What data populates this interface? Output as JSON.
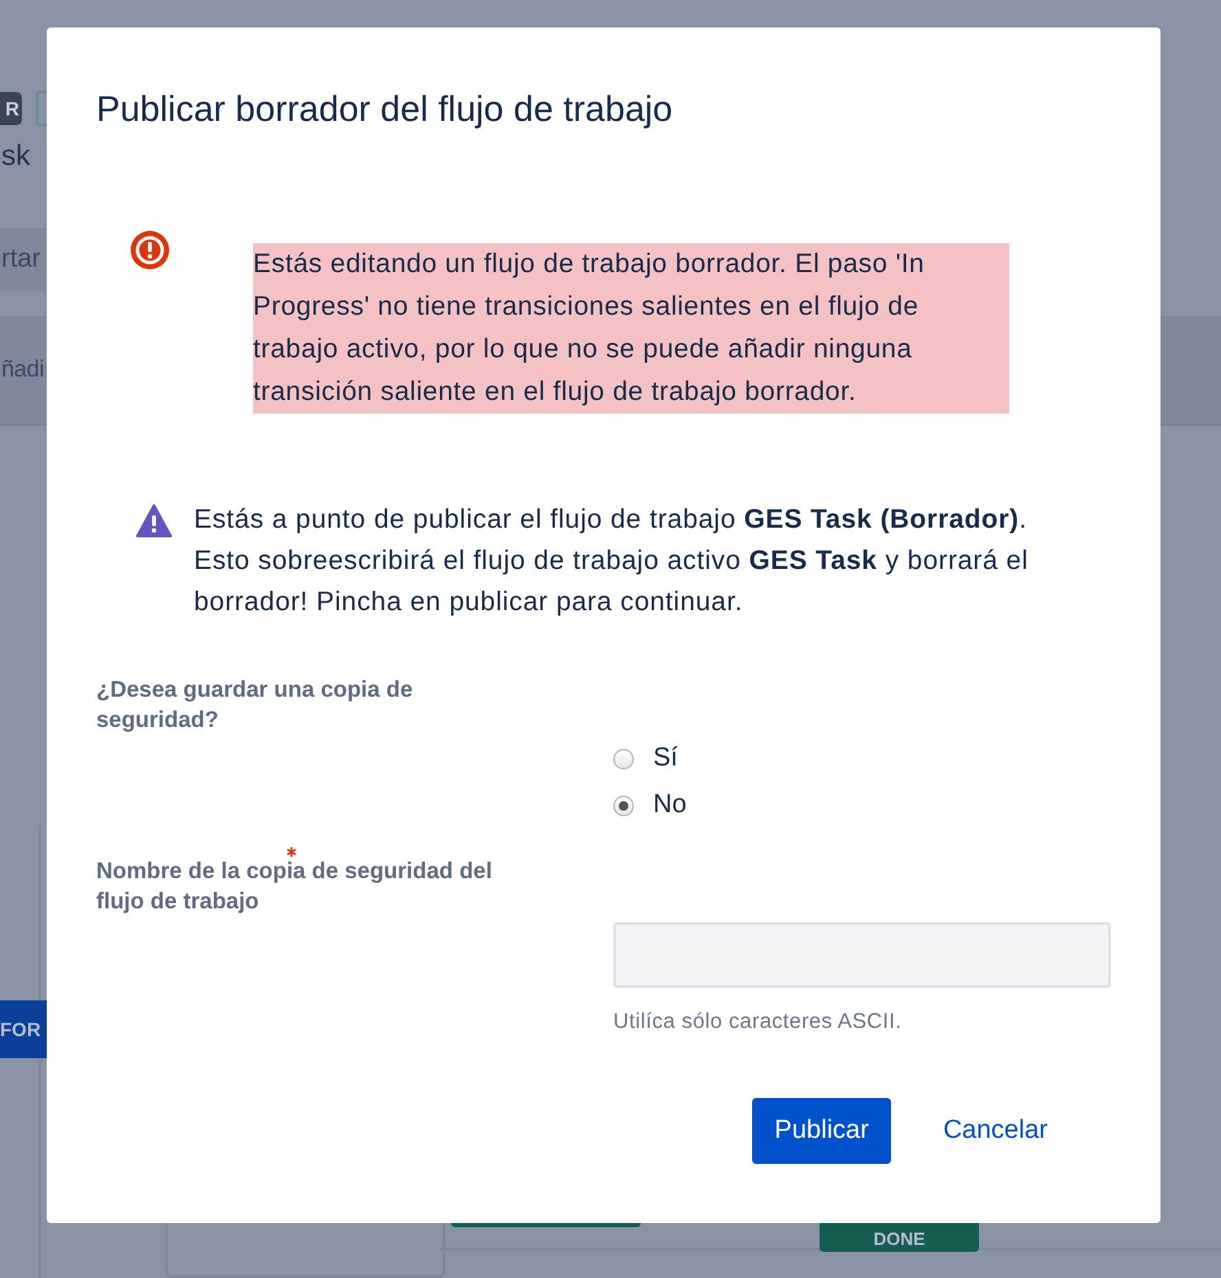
{
  "background": {
    "badge": "R",
    "heading_fragment": "sk",
    "bands": [
      "rtar",
      "ñadi"
    ],
    "nodes": [
      {
        "label": "FOR",
        "color": "#0b3f9a"
      },
      {
        "label": "DONE",
        "color": "#135e50"
      }
    ]
  },
  "dialog": {
    "title": "Publicar borrador del flujo de trabajo",
    "error": {
      "text": "Estás editando un flujo de trabajo borrador. El paso 'In Progress' no tiene transiciones salientes en el flujo de trabajo activo, por lo que no se puede añadir ninguna transición saliente en el flujo de trabajo borrador."
    },
    "warning": {
      "text": "Estás a punto de publicar el flujo de trabajo **GES Task (Borrador)**. Esto sobreescribirá el flujo de trabajo activo **GES Task** y borrará el borrador! Pincha en publicar para continuar."
    },
    "backup_question": {
      "label": "¿Desea guardar una copia de seguridad?",
      "options": [
        {
          "label": "Sí",
          "selected": false
        },
        {
          "label": "No",
          "selected": true
        }
      ]
    },
    "backup_name": {
      "label": "Nombre de la copia de seguridad del flujo de trabajo",
      "required": true,
      "hint": "Utilíca sólo caracteres ASCII."
    },
    "buttons": [
      {
        "label": "Publicar",
        "kind": "primary"
      },
      {
        "label": "Cancelar",
        "kind": "link"
      }
    ]
  }
}
